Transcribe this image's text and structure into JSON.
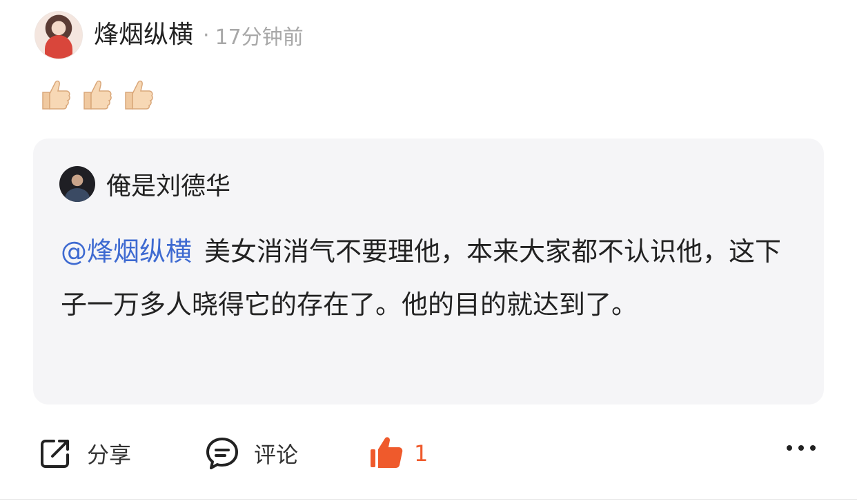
{
  "post": {
    "author": "烽烟纵横",
    "separator": "·",
    "time": "17分钟前",
    "emoji_icons": [
      "thumbs-up-emoji",
      "thumbs-up-emoji",
      "thumbs-up-emoji"
    ]
  },
  "quote": {
    "author": "俺是刘德华",
    "mention": "@烽烟纵横",
    "text": "美女消消气不要理他，本来大家都不认识他，这下子一万多人晓得它的存在了。他的目的就达到了。"
  },
  "actions": {
    "share_label": "分享",
    "comment_label": "评论",
    "like_count": "1"
  },
  "colors": {
    "mention": "#3e6ad1",
    "like_active": "#ef5a2c",
    "card_bg": "#f5f5f7",
    "meta_gray": "#a8a8a8"
  }
}
